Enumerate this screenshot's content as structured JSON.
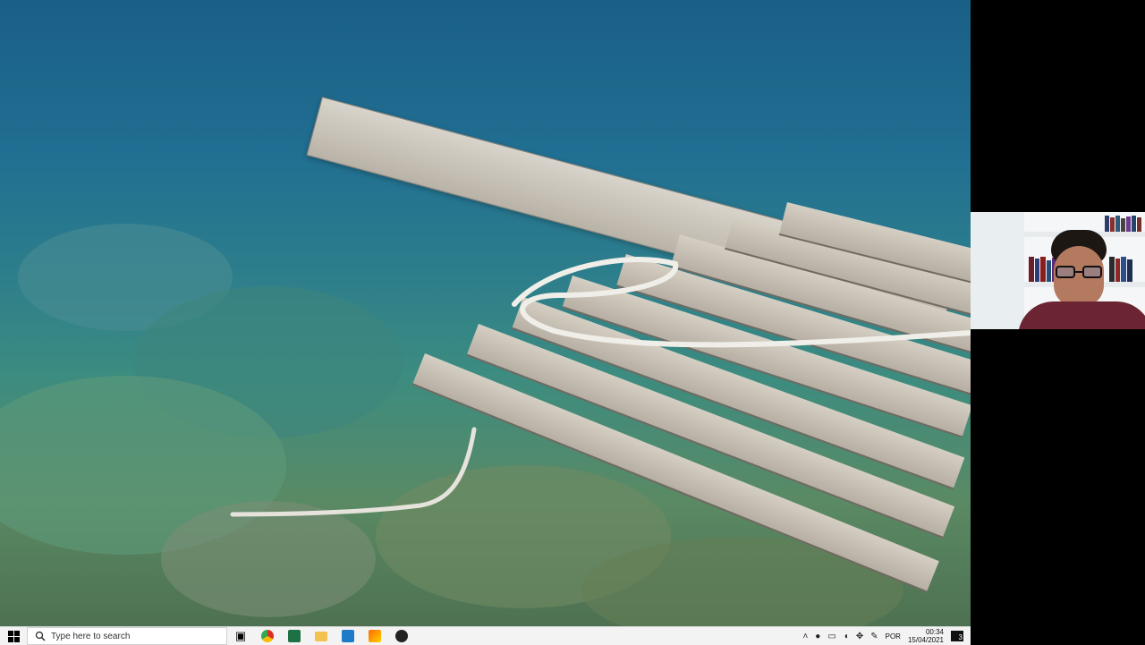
{
  "taskbar": {
    "search_placeholder": "Type here to search",
    "language": "POR",
    "time": "00:34",
    "date": "15/04/2021",
    "notification_count": "3"
  },
  "colors": {
    "taskbar_bg": "#f3f3f3",
    "water": "#216f92",
    "dock_wood": "#c8c1b6"
  },
  "icons": [
    "windows-start-icon",
    "search-icon",
    "task-view-icon",
    "chrome-icon",
    "excel-icon",
    "file-explorer-icon",
    "vscode-icon",
    "paint-icon",
    "obs-icon"
  ]
}
